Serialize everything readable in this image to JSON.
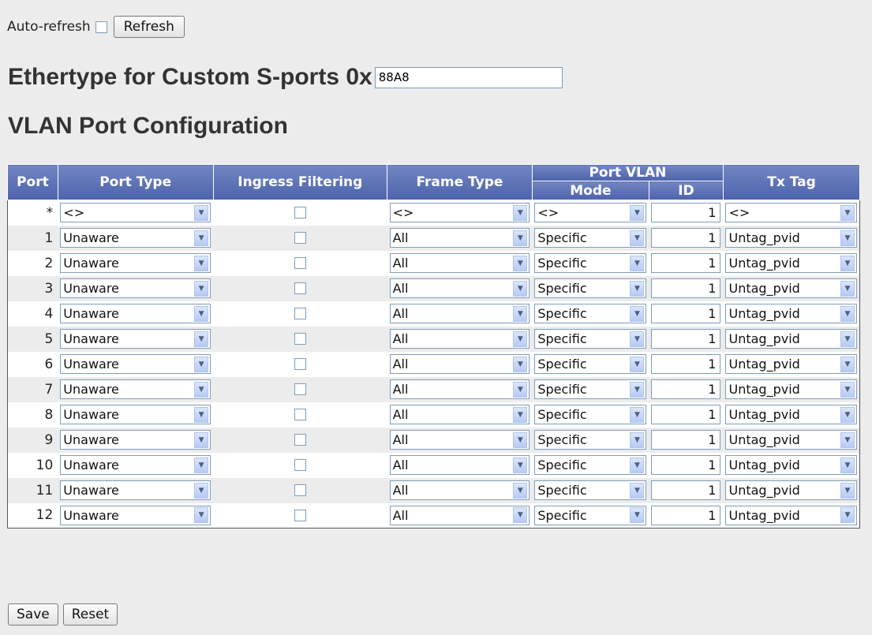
{
  "top": {
    "auto_refresh_label": "Auto-refresh",
    "auto_refresh_checked": false,
    "refresh_label": "Refresh"
  },
  "ethertype": {
    "label": "Ethertype for Custom S-ports 0x",
    "value": "88A8"
  },
  "section_title": "VLAN Port Configuration",
  "table": {
    "headers": {
      "port": "Port",
      "port_type": "Port Type",
      "ingress_filtering": "Ingress Filtering",
      "frame_type": "Frame Type",
      "port_vlan": "Port VLAN",
      "mode": "Mode",
      "id": "ID",
      "tx_tag": "Tx Tag"
    },
    "rows": [
      {
        "port": "*",
        "port_type": "<>",
        "ingress": false,
        "frame_type": "<>",
        "mode": "<>",
        "id": "1",
        "tx_tag": "<>"
      },
      {
        "port": "1",
        "port_type": "Unaware",
        "ingress": false,
        "frame_type": "All",
        "mode": "Specific",
        "id": "1",
        "tx_tag": "Untag_pvid"
      },
      {
        "port": "2",
        "port_type": "Unaware",
        "ingress": false,
        "frame_type": "All",
        "mode": "Specific",
        "id": "1",
        "tx_tag": "Untag_pvid"
      },
      {
        "port": "3",
        "port_type": "Unaware",
        "ingress": false,
        "frame_type": "All",
        "mode": "Specific",
        "id": "1",
        "tx_tag": "Untag_pvid"
      },
      {
        "port": "4",
        "port_type": "Unaware",
        "ingress": false,
        "frame_type": "All",
        "mode": "Specific",
        "id": "1",
        "tx_tag": "Untag_pvid"
      },
      {
        "port": "5",
        "port_type": "Unaware",
        "ingress": false,
        "frame_type": "All",
        "mode": "Specific",
        "id": "1",
        "tx_tag": "Untag_pvid"
      },
      {
        "port": "6",
        "port_type": "Unaware",
        "ingress": false,
        "frame_type": "All",
        "mode": "Specific",
        "id": "1",
        "tx_tag": "Untag_pvid"
      },
      {
        "port": "7",
        "port_type": "Unaware",
        "ingress": false,
        "frame_type": "All",
        "mode": "Specific",
        "id": "1",
        "tx_tag": "Untag_pvid"
      },
      {
        "port": "8",
        "port_type": "Unaware",
        "ingress": false,
        "frame_type": "All",
        "mode": "Specific",
        "id": "1",
        "tx_tag": "Untag_pvid"
      },
      {
        "port": "9",
        "port_type": "Unaware",
        "ingress": false,
        "frame_type": "All",
        "mode": "Specific",
        "id": "1",
        "tx_tag": "Untag_pvid"
      },
      {
        "port": "10",
        "port_type": "Unaware",
        "ingress": false,
        "frame_type": "All",
        "mode": "Specific",
        "id": "1",
        "tx_tag": "Untag_pvid"
      },
      {
        "port": "11",
        "port_type": "Unaware",
        "ingress": false,
        "frame_type": "All",
        "mode": "Specific",
        "id": "1",
        "tx_tag": "Untag_pvid"
      },
      {
        "port": "12",
        "port_type": "Unaware",
        "ingress": false,
        "frame_type": "All",
        "mode": "Specific",
        "id": "1",
        "tx_tag": "Untag_pvid"
      }
    ]
  },
  "bottom": {
    "save_label": "Save",
    "reset_label": "Reset"
  },
  "icons": {
    "dropdown": "chevron-down-icon",
    "checkbox": "checkbox-unchecked"
  },
  "colors": {
    "header_bg": "#5d72b6",
    "row_alt_bg": "#ececec",
    "page_bg": "#ececec"
  }
}
